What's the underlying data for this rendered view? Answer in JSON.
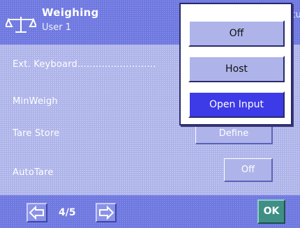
{
  "header": {
    "title": "Weighing",
    "subtitle": "User 1",
    "right_text": "Setup"
  },
  "settings": {
    "rows": [
      {
        "label": "Ext. Keyboard.........................."
      },
      {
        "label": "MinWeigh"
      },
      {
        "label": "Tare Store",
        "value": "Define"
      },
      {
        "label": "AutoTare",
        "value": "Off"
      }
    ]
  },
  "popup": {
    "options": [
      "Off",
      "Host",
      "Open Input"
    ],
    "selected": "Open Input"
  },
  "footer": {
    "page_indicator": "4/5",
    "ok_label": "OK"
  },
  "icons": {
    "scale": "scale-icon",
    "prev": "arrow-left-icon",
    "next": "arrow-right-icon"
  },
  "colors": {
    "header": "#6f78e0",
    "background": "#aeb4ea",
    "selected": "#3d3ae8",
    "ok": "#3f8f86"
  }
}
